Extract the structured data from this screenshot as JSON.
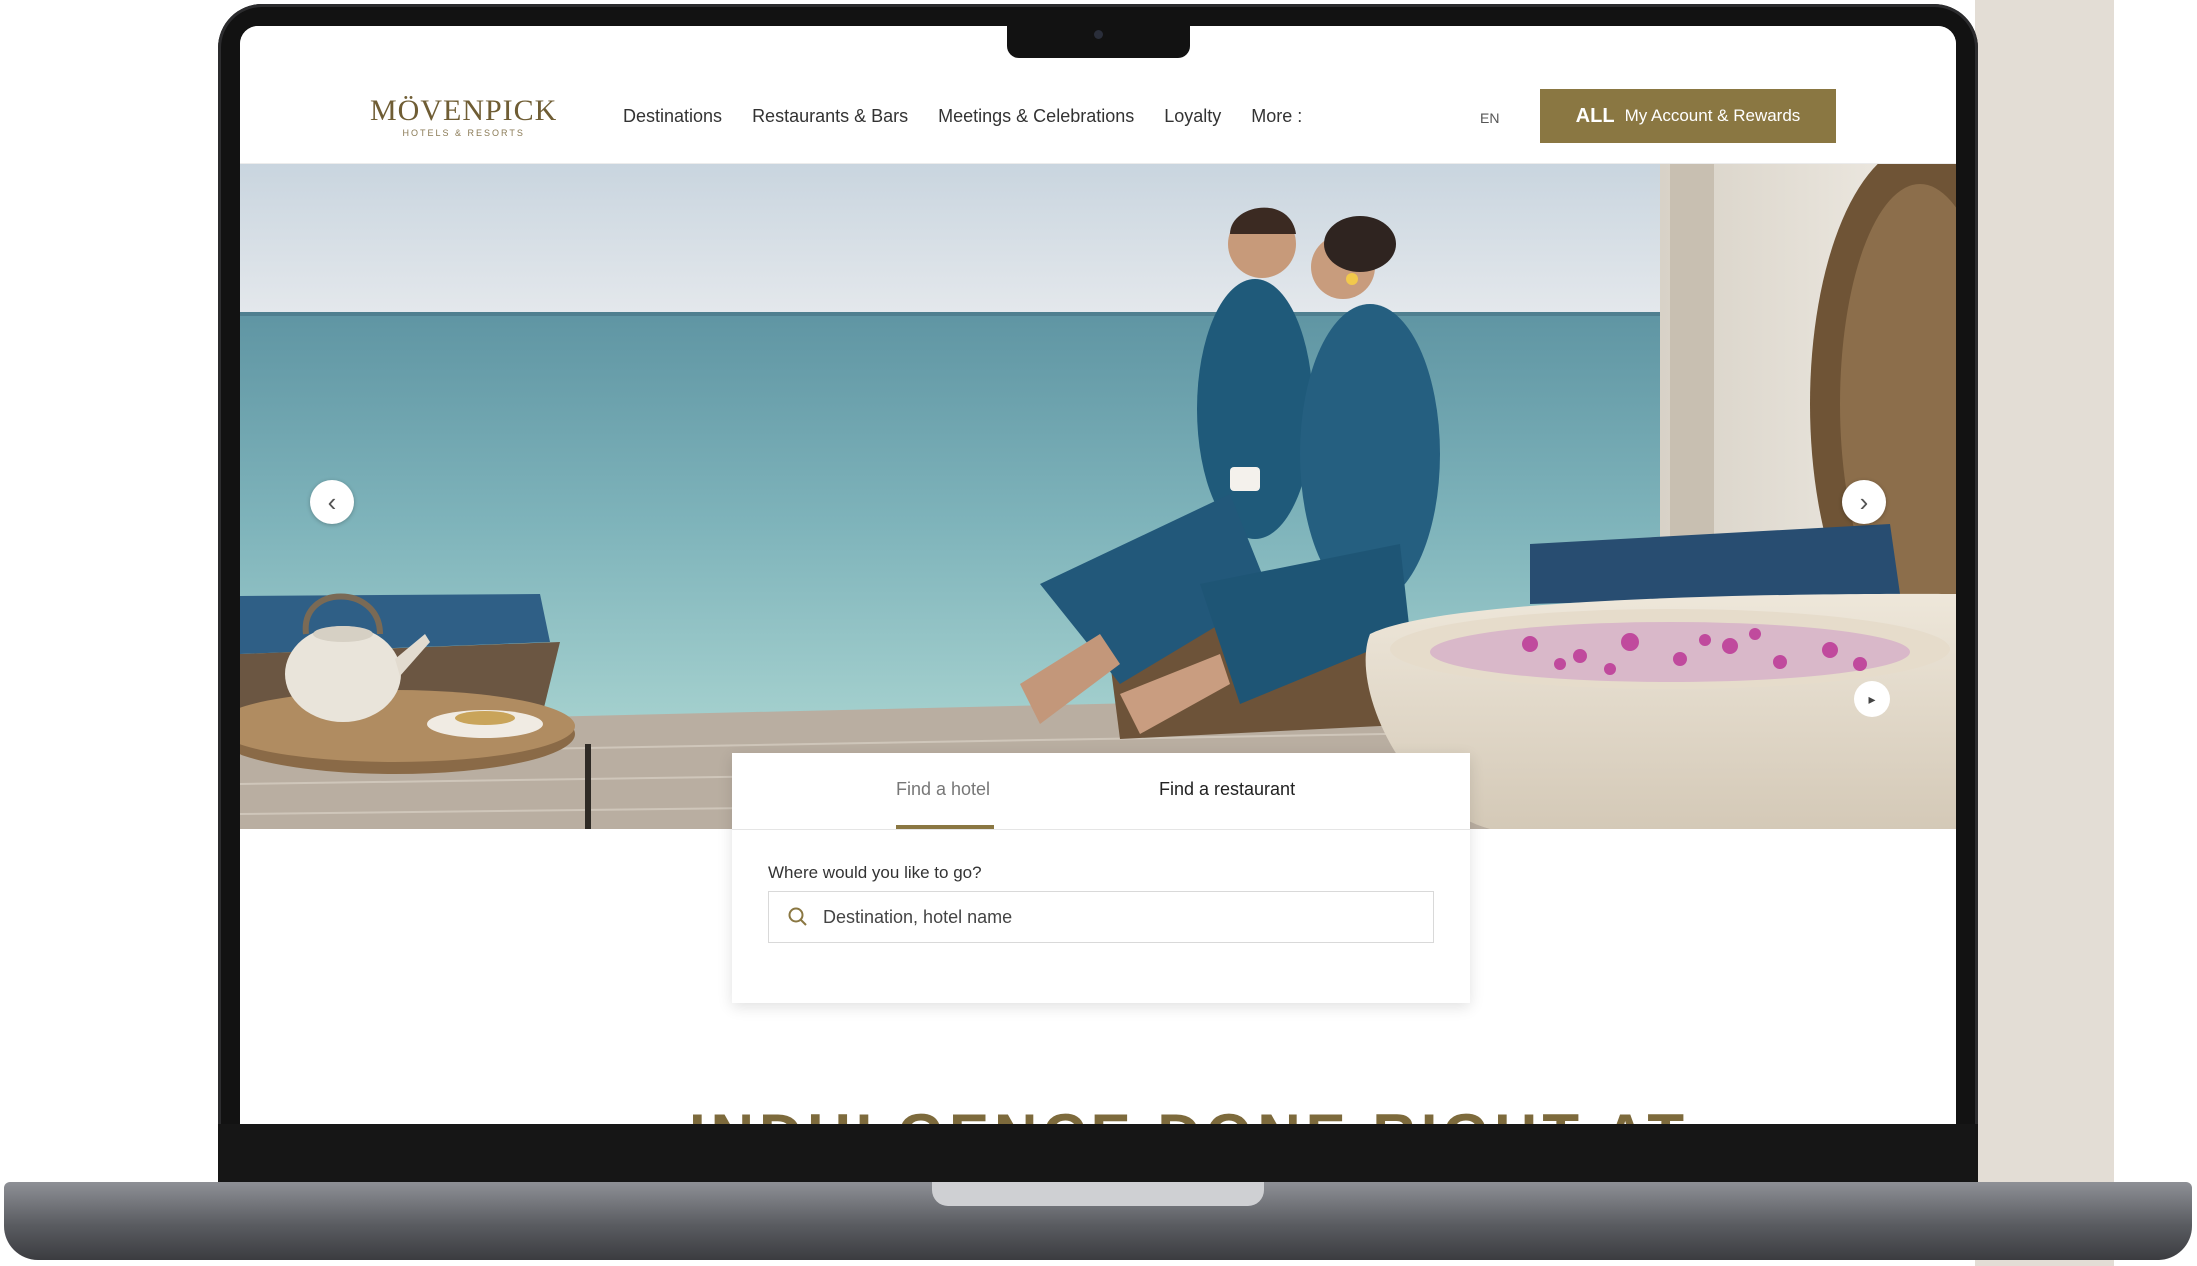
{
  "header": {
    "logo_text": "MÖVENPICK",
    "logo_subtext": "HOTELS & RESORTS",
    "nav_items": [
      "Destinations",
      "Restaurants & Bars",
      "Meetings & Celebrations",
      "Loyalty",
      "More :"
    ],
    "language": "EN",
    "account_prefix": "ALL",
    "account_label": "My Account & Rewards"
  },
  "hero": {
    "prev_icon": "‹",
    "next_icon": "›",
    "pause_icon": "▸"
  },
  "booking": {
    "tabs": [
      "Find a hotel",
      "Find a restaurant"
    ],
    "active_tab": 0,
    "field_label": "Where would you like to go?",
    "placeholder": "Destination, hotel name"
  },
  "section": {
    "heading": "INDULGENCE DONE RIGHT AT"
  },
  "colors": {
    "brand_gold": "#8a7742",
    "laptop_body": "#121212"
  }
}
